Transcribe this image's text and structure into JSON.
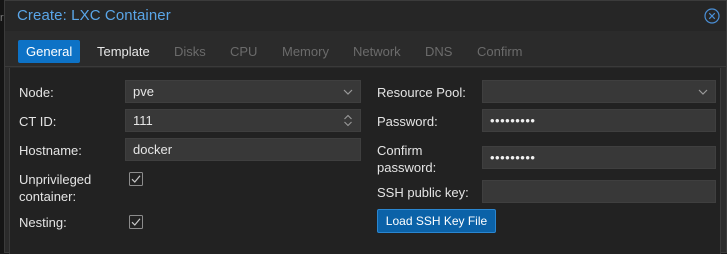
{
  "background": {
    "fragment": "rc"
  },
  "window": {
    "title": "Create: LXC Container"
  },
  "tabs": [
    {
      "label": "General",
      "state": "active"
    },
    {
      "label": "Template",
      "state": "enabled"
    },
    {
      "label": "Disks",
      "state": "disabled"
    },
    {
      "label": "CPU",
      "state": "disabled"
    },
    {
      "label": "Memory",
      "state": "disabled"
    },
    {
      "label": "Network",
      "state": "disabled"
    },
    {
      "label": "DNS",
      "state": "disabled"
    },
    {
      "label": "Confirm",
      "state": "disabled"
    }
  ],
  "form": {
    "node": {
      "label": "Node:",
      "value": "pve"
    },
    "ct_id": {
      "label": "CT ID:",
      "value": "111"
    },
    "hostname": {
      "label": "Hostname:",
      "value": "docker"
    },
    "unprivileged": {
      "label_line1": "Unprivileged",
      "label_line2": "container:",
      "checked": true
    },
    "nesting": {
      "label": "Nesting:",
      "checked": true
    },
    "resource_pool": {
      "label": "Resource Pool:",
      "value": ""
    },
    "password": {
      "label": "Password:",
      "masked_value": "•••••••••"
    },
    "confirm_password": {
      "label_line1": "Confirm",
      "label_line2": "password:",
      "masked_value": "•••••••••"
    },
    "ssh_key": {
      "label": "SSH public key:",
      "value": ""
    },
    "load_ssh_button": {
      "label": "Load SSH Key File"
    }
  },
  "colors": {
    "accent": "#0d72c6",
    "title": "#5aa6e8",
    "panel": "#222222",
    "field": "#383838"
  }
}
